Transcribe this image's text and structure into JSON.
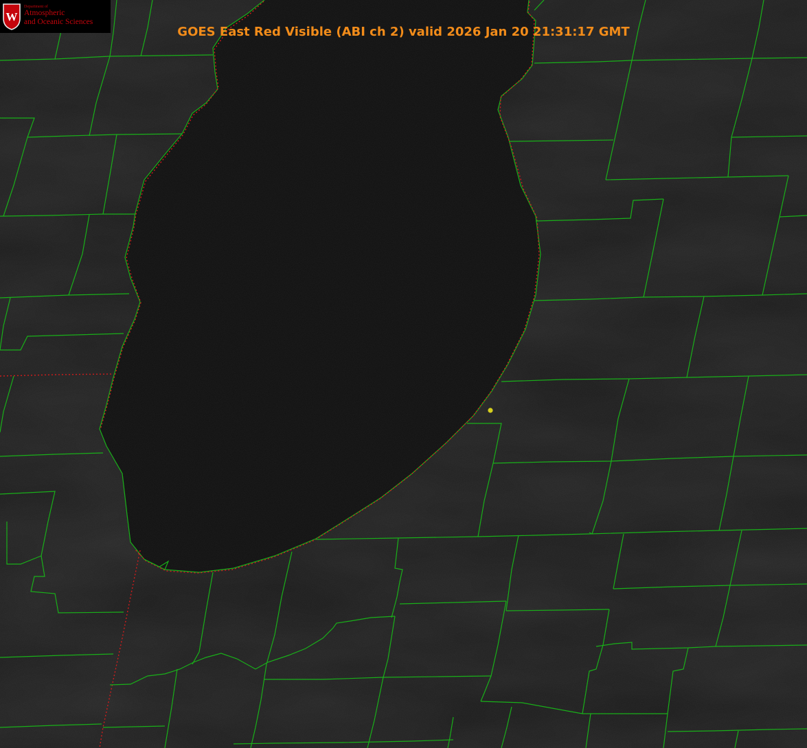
{
  "title": "GOES East Red Visible (ABI ch 2) valid 2026 Jan 20 21:31:17 GMT",
  "logo": {
    "dept_line": "Department of",
    "line1": "Atmospheric",
    "line2": "and Oceanic Sciences",
    "crest_letter": "W"
  },
  "colors": {
    "background": "#1b1b1b",
    "lake": "#111111",
    "county_lines": "#19b019",
    "state_border": "#d11c1c",
    "title": "#f28c1a",
    "logo_text": "#c5050c",
    "marker": "#d6cf1e"
  },
  "map": {
    "feature": "Lake Michigan (southern basin)",
    "marker": "yellow-dot"
  }
}
